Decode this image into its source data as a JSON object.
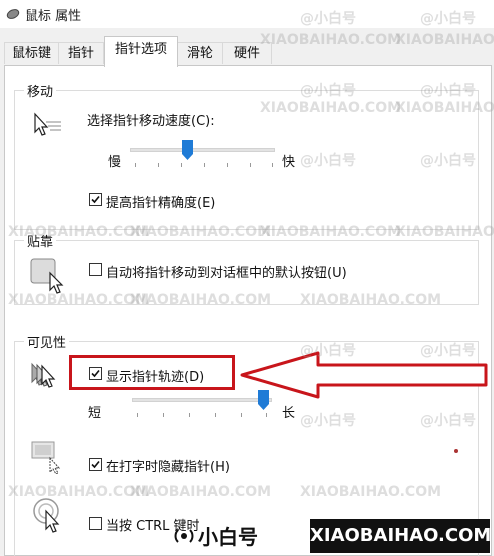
{
  "window": {
    "title": "鼠标 属性"
  },
  "tabs": [
    {
      "label": "鼠标键"
    },
    {
      "label": "指针"
    },
    {
      "label": "指针选项"
    },
    {
      "label": "滑轮"
    },
    {
      "label": "硬件"
    }
  ],
  "motion": {
    "group_title": "移动",
    "speed_label": "选择指针移动速度(C):",
    "slow_label": "慢",
    "fast_label": "快",
    "speed_level": 0.5,
    "precision_label": "提高指针精确度(E)",
    "precision_checked": true
  },
  "snap": {
    "group_title": "贴靠",
    "label": "自动将指针移动到对话框中的默认按钮(U)",
    "checked": false
  },
  "visibility": {
    "group_title": "可见性",
    "trails_label": "显示指针轨迹(D)",
    "trails_checked": true,
    "short_label": "短",
    "long_label": "长",
    "trail_level": 1.0,
    "hide_label": "在打字时隐藏指针(H)",
    "hide_checked": true,
    "ctrl_label": "当按 CTRL 键时"
  },
  "watermark": {
    "text_cn": "@小白号",
    "text_en": "XIAOBAIHAO.COM"
  },
  "banner": {
    "brand_cn": "小白号",
    "brand_en": "XIAOBAIHAO.COM"
  },
  "colors": {
    "highlight": "#c8151b",
    "slider_thumb": "#1f7bd6"
  }
}
